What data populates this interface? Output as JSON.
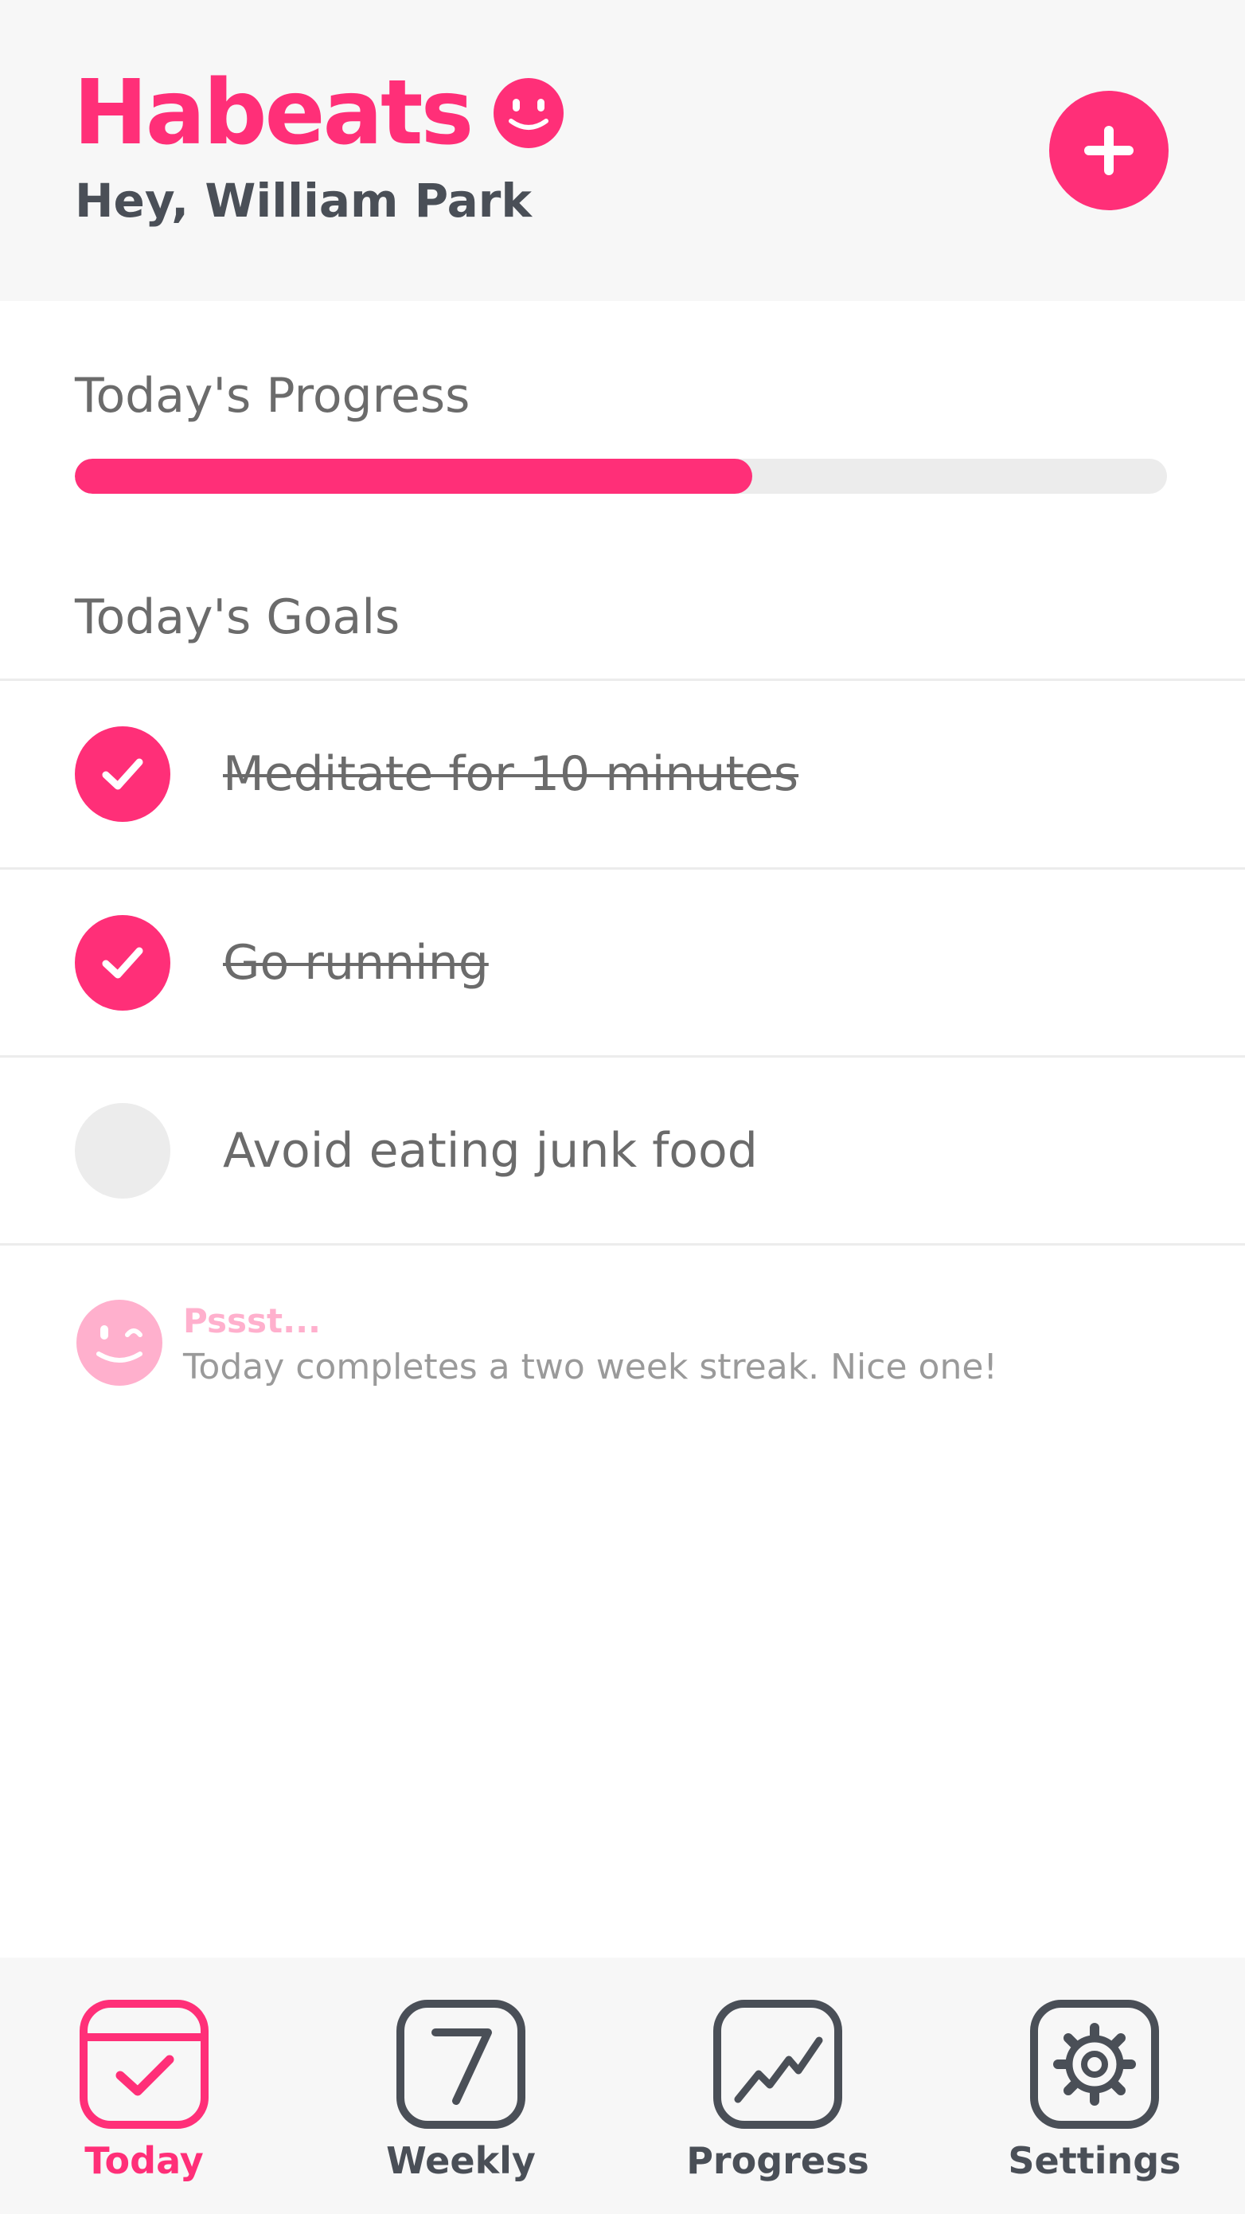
{
  "app": {
    "name": "Habeats",
    "greeting": "Hey, William Park"
  },
  "colors": {
    "accent": "#ff2f78",
    "accent_light": "#ffb0cd",
    "text_dark": "#4a4f57",
    "text_muted": "#6b6b6b",
    "track": "#ececec"
  },
  "header": {
    "add_button_icon": "plus-icon",
    "brand_icon": "smiley-icon"
  },
  "progress": {
    "title": "Today's Progress",
    "fraction": 0.62
  },
  "goals": {
    "title": "Today's Goals",
    "items": [
      {
        "label": "Meditate for 10 minutes",
        "done": true
      },
      {
        "label": "Go running",
        "done": true
      },
      {
        "label": "Avoid eating junk food",
        "done": false
      }
    ]
  },
  "tip": {
    "title": "Pssst...",
    "body": "Today completes a two week streak. Nice one!",
    "icon": "winking-face-icon"
  },
  "tabs": [
    {
      "label": "Today",
      "icon": "calendar-check-icon",
      "active": true
    },
    {
      "label": "Weekly",
      "icon": "seven-icon",
      "active": false
    },
    {
      "label": "Progress",
      "icon": "chart-line-icon",
      "active": false
    },
    {
      "label": "Settings",
      "icon": "gear-icon",
      "active": false
    }
  ]
}
